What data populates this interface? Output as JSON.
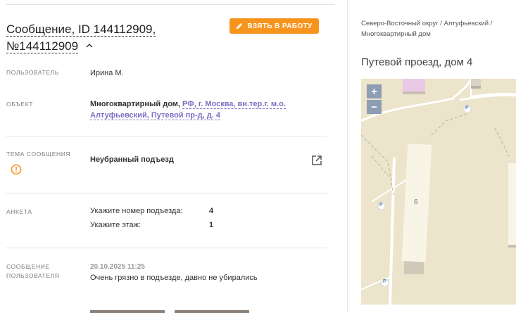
{
  "header": {
    "title_line1": "Сообщение, ID 144112909,",
    "title_line2": "№144112909",
    "take_button": "ВЗЯТЬ В РАБОТУ"
  },
  "fields": {
    "user_label": "ПОЛЬЗОВАТЕЛЬ",
    "user_value": "Ирина М.",
    "object_label": "ОБЪЕКТ",
    "object_type": "Многоквартирный дом,",
    "object_address": "РФ, г. Москва, вн.тер.г. м.о. Алтуфьевский, Путевой пр-д, д. 4",
    "topic_label": "ТЕМА СООБЩЕНИЯ",
    "topic_value": "Неубранный подъезд",
    "anketa_label": "АНКЕТА",
    "anketa": [
      {
        "question": "Укажите номер подъезда:",
        "answer": "4"
      },
      {
        "question": "Укажите этаж:",
        "answer": "1"
      }
    ],
    "message_label_1": "СООБЩЕНИЕ",
    "message_label_2": "ПОЛЬЗОВАТЕЛЯ",
    "message_date": "20.10.2025 11:25",
    "message_text": "Очень грязно в подъезде, давно не убирались"
  },
  "location": {
    "breadcrumb_1": "Северо-Восточный округ / Алтуфьевский /",
    "breadcrumb_2": "Многоквартирный дом",
    "title": "Путевой проезд, дом 4"
  },
  "map": {
    "zoom_in": "+",
    "zoom_out": "−",
    "building_number": "6",
    "parking_label": "P"
  },
  "colors": {
    "accent": "#f7941d",
    "link": "#7b6fc4",
    "map_bg": "#ece4cb"
  }
}
